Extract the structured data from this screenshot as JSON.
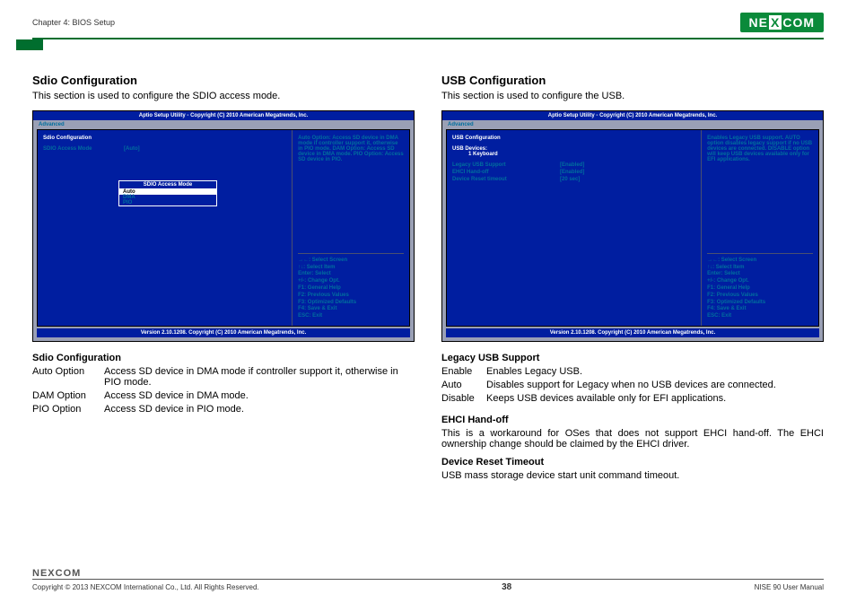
{
  "header": {
    "chapter": "Chapter 4: BIOS Setup",
    "brand": "NEXCOM"
  },
  "left": {
    "title": "Sdio Configuration",
    "desc": "This section is used to configure the SDIO access mode.",
    "bios": {
      "top": "Aptio Setup Utility - Copyright (C) 2010 American Megatrends, Inc.",
      "tab": "Advanced",
      "section": "Sdio Configuration",
      "field_label": "SDIO Access Mode",
      "field_value": "[Auto]",
      "popup_title": "SDIO Access Mode",
      "popup_items": [
        "Auto",
        "DMA",
        "PIO"
      ],
      "help": "Auto Option: Access SD device in DMA mode if controller support it, otherwise in PIO mode. DAM Option: Access SD device in DMA mode. PIO Option: Access SD device in PIO.",
      "keys": "→←: Select Screen\n↑↓: Select Item\nEnter: Select\n+/-: Change Opt.\nF1: General Help\nF2: Previous Values\nF3: Optimized Defaults\nF4: Save & Exit\nESC: Exit",
      "version": "Version 2.10.1208. Copyright (C) 2010 American Megatrends, Inc."
    },
    "defs": {
      "title": "Sdio Configuration",
      "rows": [
        {
          "term": "Auto Option",
          "desc": "Access SD device in DMA mode if controller support it, otherwise in PIO mode."
        },
        {
          "term": "DAM Option",
          "desc": "Access SD device in DMA mode."
        },
        {
          "term": "PIO Option",
          "desc": "Access SD device in PIO mode."
        }
      ]
    }
  },
  "right": {
    "title": "USB Configuration",
    "desc": "This section is used to configure the USB.",
    "bios": {
      "top": "Aptio Setup Utility - Copyright (C) 2010 American Megatrends, Inc.",
      "tab": "Advanced",
      "section": "USB Configuration",
      "devices_label": "USB Devices:",
      "devices_value": "1 Keyboard",
      "rows": [
        {
          "label": "Legacy USB Support",
          "value": "[Enabled]"
        },
        {
          "label": "EHCI Hand-off",
          "value": "[Enabled]"
        },
        {
          "label": "Device Reset timeout",
          "value": "[20 sec]"
        }
      ],
      "help": "Enables Legacy USB support. AUTO option disables legacy support if no USB devices are connected. DISABLE option will keep USB devices available only for EFI applications.",
      "keys": "→←: Select Screen\n↑↓: Select Item\nEnter: Select\n+/-: Change Opt.\nF1: General Help\nF2: Previous Values\nF3: Optimized Defaults\nF4: Save & Exit\nESC: Exit",
      "version": "Version 2.10.1208. Copyright (C) 2010 American Megatrends, Inc."
    },
    "defs1": {
      "title": "Legacy USB Support",
      "rows": [
        {
          "term": "Enable",
          "desc": "Enables Legacy USB."
        },
        {
          "term": "Auto",
          "desc": "Disables support for Legacy when no USB devices are connected."
        },
        {
          "term": "Disable",
          "desc": "Keeps USB devices available only for EFI applications."
        }
      ]
    },
    "defs2": {
      "title": "EHCI Hand-off",
      "para": "This is a workaround for OSes that does not support EHCI hand-off. The EHCI ownership change should be claimed by the EHCI driver."
    },
    "defs3": {
      "title": "Device Reset Timeout",
      "para": "USB mass storage device start unit command timeout."
    }
  },
  "footer": {
    "copyright": "Copyright © 2013 NEXCOM International Co., Ltd. All Rights Reserved.",
    "page": "38",
    "manual": "NISE 90 User Manual",
    "brand": "NEXCOM"
  }
}
